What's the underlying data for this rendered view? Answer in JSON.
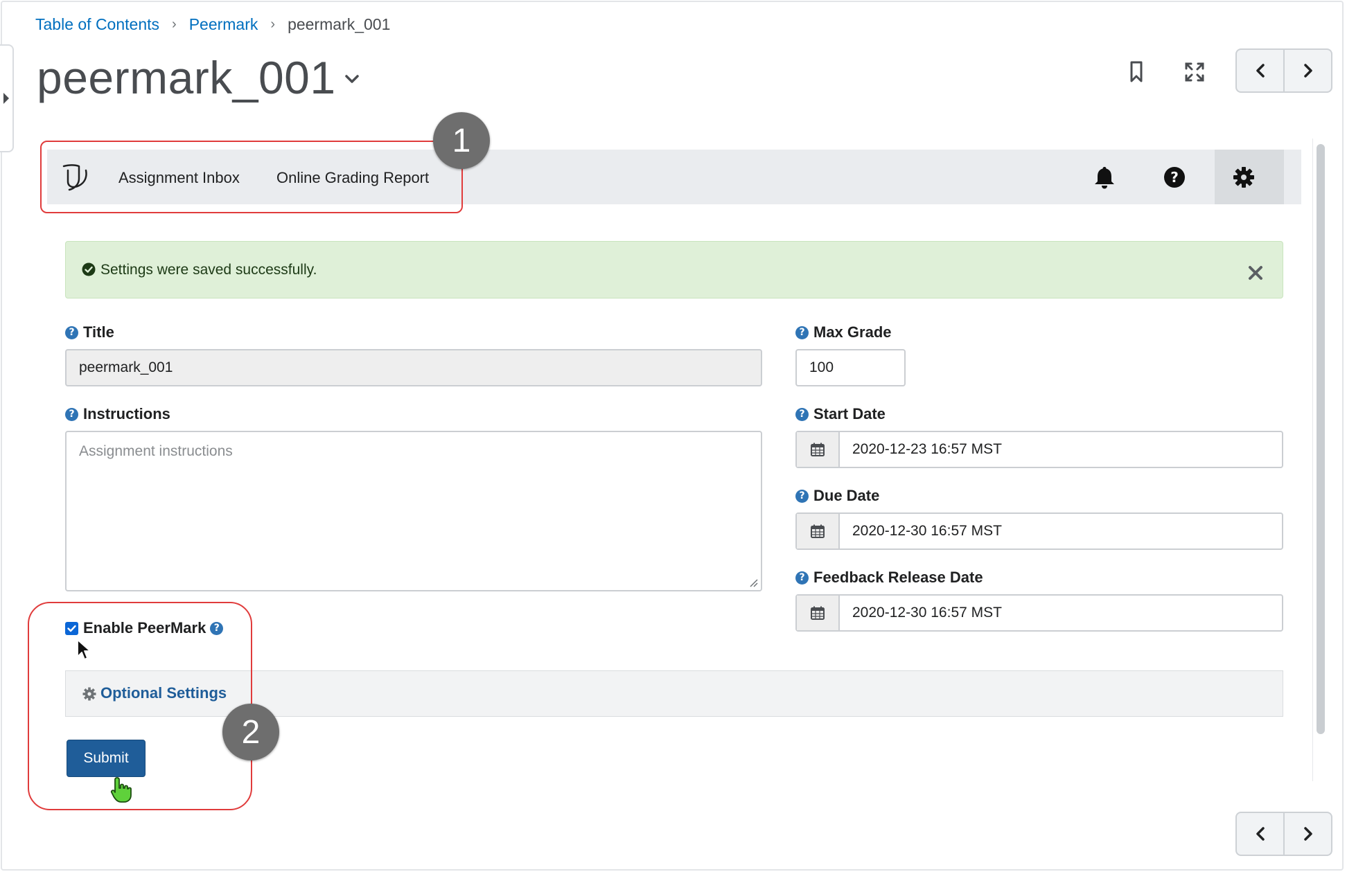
{
  "breadcrumb": {
    "items": [
      "Table of Contents",
      "Peermark"
    ],
    "current": "peermark_001",
    "separator": "›"
  },
  "page": {
    "title": "peermark_001"
  },
  "toolbar": {
    "logo_icon": "turnitin-logo-icon",
    "links": [
      "Assignment Inbox",
      "Online Grading Report"
    ],
    "icons": [
      "bell-icon",
      "help-icon",
      "gear-icon"
    ]
  },
  "alert": {
    "message": "Settings were saved successfully.",
    "icon": "check-circle-icon",
    "close_icon": "close-icon"
  },
  "form": {
    "title": {
      "label": "Title",
      "value": "peermark_001"
    },
    "instructions": {
      "label": "Instructions",
      "placeholder": "Assignment instructions"
    },
    "max_grade": {
      "label": "Max Grade",
      "value": "100"
    },
    "start_date": {
      "label": "Start Date",
      "value": "2020-12-23 16:57 MST"
    },
    "due_date": {
      "label": "Due Date",
      "value": "2020-12-30 16:57 MST"
    },
    "feedback_release_date": {
      "label": "Feedback Release Date",
      "value": "2020-12-30 16:57 MST"
    },
    "enable_peermark": {
      "label": "Enable PeerMark",
      "checked": true
    },
    "optional_settings": {
      "label": "Optional Settings"
    },
    "submit_label": "Submit"
  },
  "annotations": {
    "badge1": "1",
    "badge2": "2"
  },
  "colors": {
    "link": "#006fbf",
    "primary_button": "#1f5d99",
    "alert_bg": "#dff0d8",
    "highlight": "#e03b3b",
    "help_icon": "#2f74b5"
  }
}
